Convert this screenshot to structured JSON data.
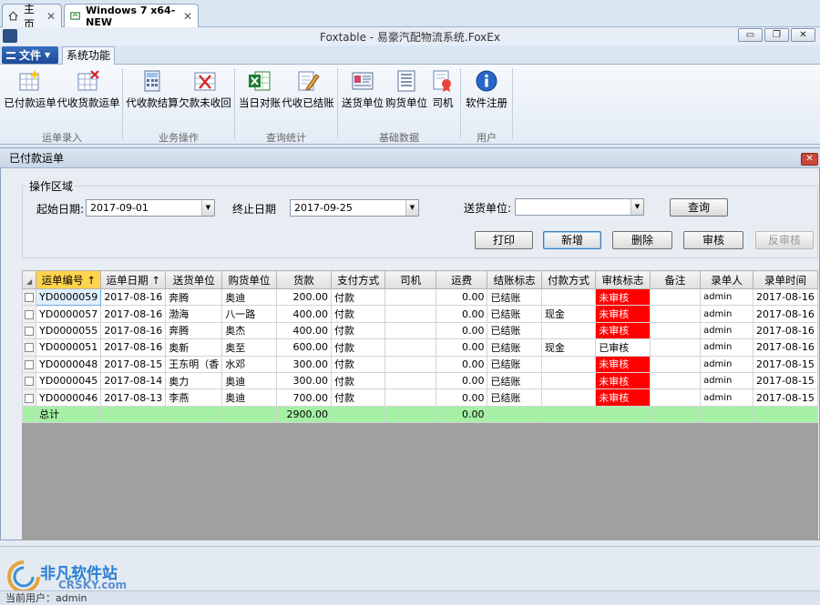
{
  "browser_tabs": [
    {
      "label": "主页",
      "icon": "home-icon"
    },
    {
      "label": "Windows 7 x64-NEW",
      "icon": "vm-icon"
    }
  ],
  "window": {
    "title": "Foxtable - 易豪汽配物流系统.FoxEx",
    "app_icon": "foxtable-icon",
    "controls": [
      "minimize",
      "restore",
      "close"
    ]
  },
  "ribbon": {
    "file_label": "文件",
    "active_tab": "系统功能",
    "groups": [
      {
        "label": "运单录入",
        "buttons": [
          {
            "label": "已付款运单",
            "icon": "table-add-icon"
          },
          {
            "label": "代收货款运单",
            "icon": "table-delete-icon"
          }
        ]
      },
      {
        "label": "业务操作",
        "buttons": [
          {
            "label": "代收款结算",
            "icon": "calculator-icon"
          },
          {
            "label": "欠款未收回",
            "icon": "table-cross-icon"
          }
        ]
      },
      {
        "label": "查询统计",
        "buttons": [
          {
            "label": "当日对账",
            "icon": "excel-icon"
          },
          {
            "label": "代收已结账",
            "icon": "edit-doc-icon"
          }
        ]
      },
      {
        "label": "基础数据",
        "buttons": [
          {
            "label": "送货单位",
            "icon": "card-icon"
          },
          {
            "label": "购货单位",
            "icon": "list-icon"
          },
          {
            "label": "司机",
            "icon": "certificate-icon"
          }
        ]
      },
      {
        "label": "用户",
        "buttons": [
          {
            "label": "软件注册",
            "icon": "info-icon"
          }
        ]
      }
    ]
  },
  "form": {
    "title": "已付款运单",
    "group_label": "操作区域",
    "start_label": "起始日期:",
    "start_value": "2017-09-01",
    "end_label": "终止日期",
    "end_value": "2017-09-25",
    "sender_label": "送货单位:",
    "sender_value": "",
    "query_btn": "查询",
    "print_btn": "打印",
    "new_btn": "新增",
    "delete_btn": "删除",
    "audit_btn": "审核",
    "unaudit_btn": "反审核"
  },
  "grid": {
    "columns": [
      "运单编号 ↑",
      "运单日期 ↑",
      "送货单位",
      "购货单位",
      "货款",
      "支付方式",
      "司机",
      "运费",
      "结账标志",
      "付款方式",
      "审核标志",
      "备注",
      "录单人",
      "录单时间"
    ],
    "rows": [
      [
        "YD0000059",
        "2017-08-16",
        "奔腾",
        "奥迪",
        "200.00",
        "付款",
        "",
        "0.00",
        "已结账",
        "",
        "未审核",
        "",
        "admin",
        "2017-08-16"
      ],
      [
        "YD0000057",
        "2017-08-16",
        "渤海",
        "八一路",
        "400.00",
        "付款",
        "",
        "0.00",
        "已结账",
        "现金",
        "未审核",
        "",
        "admin",
        "2017-08-16"
      ],
      [
        "YD0000055",
        "2017-08-16",
        "奔腾",
        "奥杰",
        "400.00",
        "付款",
        "",
        "0.00",
        "已结账",
        "",
        "未审核",
        "",
        "admin",
        "2017-08-16"
      ],
      [
        "YD0000051",
        "2017-08-16",
        "奥新",
        "奥至",
        "600.00",
        "付款",
        "",
        "0.00",
        "已结账",
        "现金",
        "已审核",
        "",
        "admin",
        "2017-08-16"
      ],
      [
        "YD0000048",
        "2017-08-15",
        "王东明（香",
        "水邓",
        "300.00",
        "付款",
        "",
        "0.00",
        "已结账",
        "",
        "未审核",
        "",
        "admin",
        "2017-08-15"
      ],
      [
        "YD0000045",
        "2017-08-14",
        "奥力",
        "奥迪",
        "300.00",
        "付款",
        "",
        "0.00",
        "已结账",
        "",
        "未审核",
        "",
        "admin",
        "2017-08-15"
      ],
      [
        "YD0000046",
        "2017-08-13",
        "李燕",
        "奥迪",
        "700.00",
        "付款",
        "",
        "0.00",
        "已结账",
        "",
        "未审核",
        "",
        "admin",
        "2017-08-15"
      ]
    ],
    "total": {
      "label": "总计",
      "goods": "2900.00",
      "freight": "0.00"
    }
  },
  "watermark": {
    "text": "非凡软件站",
    "sub": "CRSKY.com"
  },
  "status": {
    "text": "当前用户：admin"
  },
  "colors": {
    "unaudited_bg": "#ff0000",
    "total_row_bg": "#a6f0a6",
    "selected_header": "#ffd34d"
  }
}
